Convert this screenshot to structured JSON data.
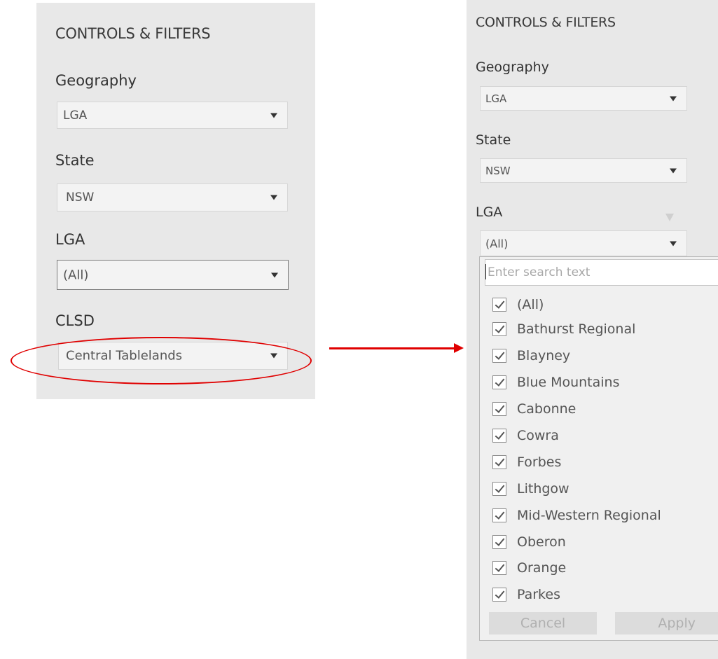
{
  "left_panel": {
    "title": "CONTROLS & FILTERS",
    "geography": {
      "label": "Geography",
      "value": "LGA"
    },
    "state": {
      "label": "State",
      "value": "NSW"
    },
    "lga": {
      "label": "LGA",
      "value": "(All)"
    },
    "clsd": {
      "label": "CLSD",
      "value": "Central Tablelands"
    }
  },
  "right_panel": {
    "title": "CONTROLS & FILTERS",
    "geography": {
      "label": "Geography",
      "value": "LGA"
    },
    "state": {
      "label": "State",
      "value": "NSW"
    },
    "lga": {
      "label": "LGA",
      "value": "(All)"
    },
    "dropdown": {
      "search_placeholder": "Enter search text",
      "options": [
        {
          "label": "(All)",
          "checked": true
        },
        {
          "label": "Bathurst Regional",
          "checked": true
        },
        {
          "label": "Blayney",
          "checked": true
        },
        {
          "label": "Blue Mountains",
          "checked": true
        },
        {
          "label": "Cabonne",
          "checked": true
        },
        {
          "label": "Cowra",
          "checked": true
        },
        {
          "label": "Forbes",
          "checked": true
        },
        {
          "label": "Lithgow",
          "checked": true
        },
        {
          "label": "Mid-Western Regional",
          "checked": true
        },
        {
          "label": "Oberon",
          "checked": true
        },
        {
          "label": "Orange",
          "checked": true
        },
        {
          "label": "Parkes",
          "checked": true
        }
      ],
      "cancel_label": "Cancel",
      "apply_label": "Apply"
    }
  },
  "colors": {
    "panel_bg": "#e8e8e8",
    "annotation": "#e00000"
  },
  "icons": {
    "caret": "chevron-down-icon",
    "filter": "filter-icon",
    "checkbox": "checkbox-checked-icon"
  }
}
